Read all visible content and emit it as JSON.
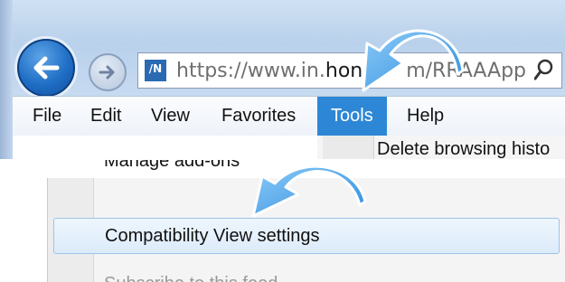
{
  "browser": {
    "address_bar": {
      "url_prefix": "https://www.in.",
      "url_domain_visible": "hond",
      "url_hidden_part": "",
      "url_suffix": "m/RRAAApp"
    },
    "menu_bar": {
      "items": [
        {
          "label": "File"
        },
        {
          "label": "Edit"
        },
        {
          "label": "View"
        },
        {
          "label": "Favorites"
        },
        {
          "label": "Tools",
          "active": true
        },
        {
          "label": "Help"
        }
      ]
    },
    "tools_menu_top_item": "Delete browsing histo"
  },
  "tools_menu": {
    "items": [
      {
        "label": "Manage add-ons",
        "state": "partially visible"
      },
      {
        "label": "Compatibility View settings",
        "state": "highlighted"
      },
      {
        "label": "Subscribe to this feed...",
        "state": "partially visible"
      }
    ]
  },
  "icons": {
    "back": "back-arrow-icon",
    "forward": "forward-arrow-icon",
    "site": "site-favicon-icon",
    "search": "search-icon",
    "annotation": "curved-pointer-arrow-icon"
  },
  "colors": {
    "menu_highlight": "#2e87d6",
    "back_button": "#1f6fc6",
    "annotation_arrow": "#3d9be9",
    "compat_highlight": "#dcebfa"
  }
}
